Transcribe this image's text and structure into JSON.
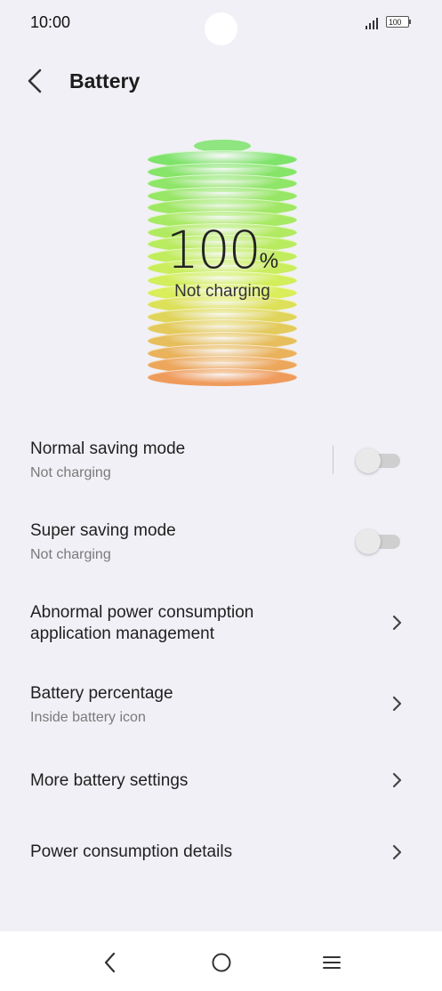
{
  "status_bar": {
    "time": "10:00",
    "battery_level": "100",
    "icons": [
      "signal-icon",
      "battery-icon"
    ]
  },
  "header": {
    "title": "Battery",
    "back_icon": "chevron-left-icon"
  },
  "battery": {
    "percent_value": "100",
    "percent_sign": "%",
    "status": "Not charging",
    "level": 1.0,
    "colors": {
      "top": "#7ee36a",
      "mid": "#d9ef5a",
      "bottom": "#ef9b5c"
    }
  },
  "settings": [
    {
      "title": "Normal saving mode",
      "subtitle": "Not charging",
      "control": "toggle",
      "enabled": false
    },
    {
      "title": "Super saving mode",
      "subtitle": "Not charging",
      "control": "toggle",
      "enabled": false
    },
    {
      "title": "Abnormal power consumption",
      "title_line2": "application management",
      "control": "chevron"
    },
    {
      "title": "Battery percentage",
      "subtitle": "Inside battery icon",
      "control": "chevron"
    },
    {
      "title": "More battery settings",
      "control": "chevron"
    },
    {
      "title": "Power consumption details",
      "control": "chevron"
    }
  ],
  "nav_bar": {
    "buttons": [
      "back-icon",
      "home-icon",
      "recents-icon"
    ]
  },
  "colors": {
    "background": "#f1f0f6",
    "text_primary": "#1f1f1f",
    "text_secondary": "#7a7a7a",
    "toggle_off": "#cfcfcf"
  }
}
